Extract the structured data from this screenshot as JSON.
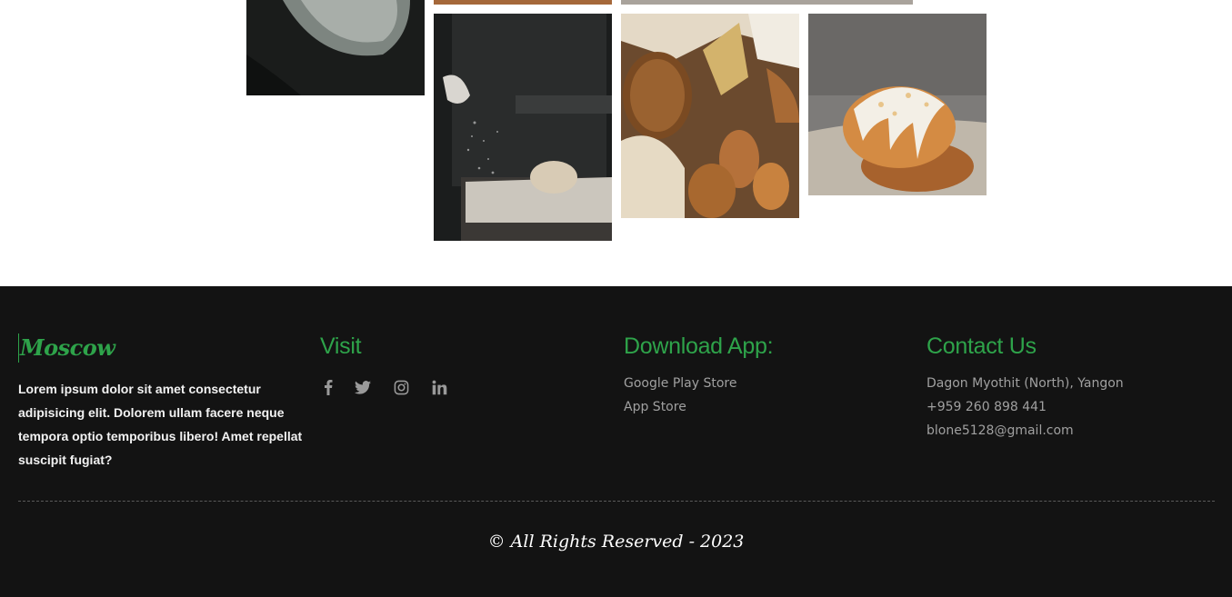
{
  "footer": {
    "brand": "Moscow",
    "about": "Lorem ipsum dolor sit amet consectetur adipisicing elit. Dolorem ullam facere neque tempora optio temporibus libero! Amet repellat suscipit fugiat?",
    "visit": {
      "heading": "Visit",
      "social": [
        {
          "icon": "facebook-icon",
          "glyph": "f"
        },
        {
          "icon": "twitter-icon",
          "glyph": "🐦"
        },
        {
          "icon": "instagram-icon",
          "glyph": "◎"
        },
        {
          "icon": "linkedin-icon",
          "glyph": "in"
        }
      ]
    },
    "download": {
      "heading": "Download App:",
      "links": [
        "Google Play Store",
        "App Store"
      ]
    },
    "contact": {
      "heading": "Contact Us",
      "address": "Dagon Myothit (North), Yangon",
      "phone": "+959 260 898 441",
      "email": "blone5128@gmail.com"
    },
    "copyright": "© All Rights Reserved - 2023"
  },
  "colors": {
    "accent": "#2ea34a",
    "footer_bg": "#131313",
    "muted_text": "#a0a0a0"
  }
}
